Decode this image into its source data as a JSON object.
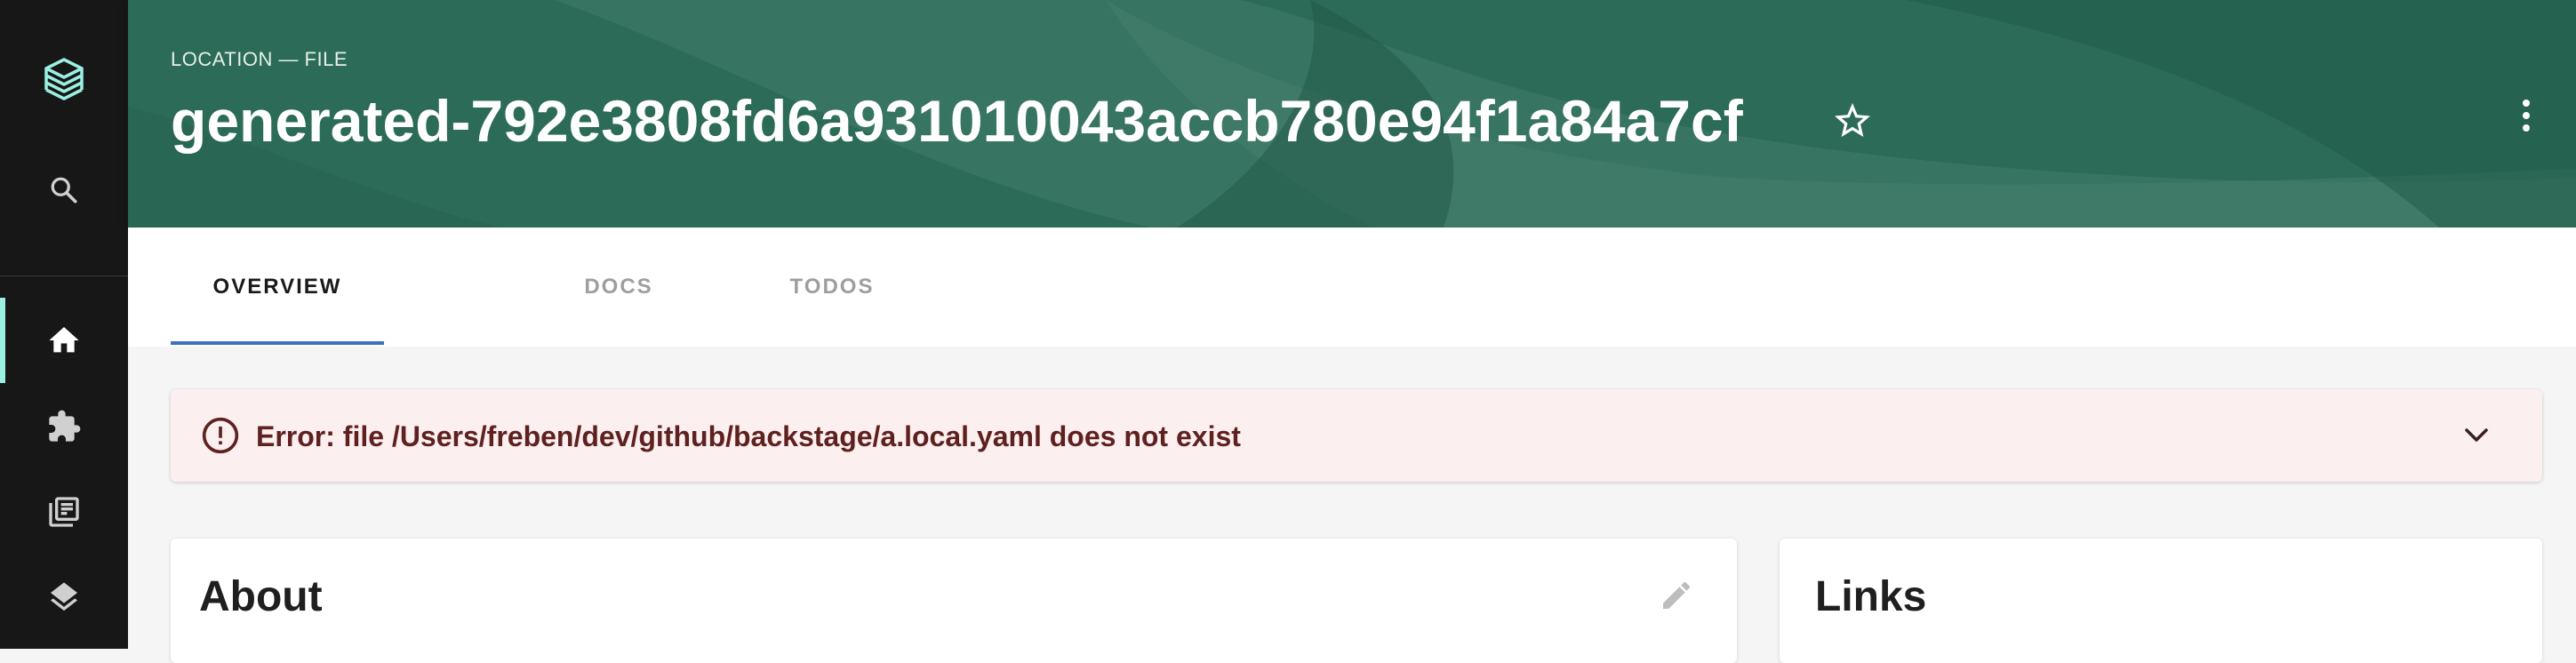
{
  "sidebar": {
    "items": [
      {
        "icon": "backstage-logo-icon"
      },
      {
        "icon": "search-icon"
      },
      {
        "icon": "home-icon",
        "active": true
      },
      {
        "icon": "puzzle-icon"
      },
      {
        "icon": "library-books-icon"
      },
      {
        "icon": "layers-icon"
      }
    ],
    "active_accent": "#9bf0e1"
  },
  "header": {
    "type_label": "LOCATION — FILE",
    "title": "generated-792e3808fd6a931010043accb780e94f1a84a7cf",
    "star_icon": "star-outline-icon",
    "menu_icon": "more-vert-icon",
    "background_color": "#2b6b57"
  },
  "tabs": [
    {
      "label": "OVERVIEW",
      "active": true
    },
    {
      "label": "DOCS",
      "active": false
    },
    {
      "label": "TODOS",
      "active": false
    }
  ],
  "alert": {
    "message": "Error: file /Users/freben/dev/github/backstage/a.local.yaml does not exist",
    "icon": "error-outline-icon",
    "toggle_icon": "chevron-down-icon",
    "color": "#5f2120",
    "background": "#fbefef"
  },
  "cards": {
    "about": {
      "title": "About",
      "edit_icon": "pencil-icon"
    },
    "links": {
      "title": "Links"
    }
  }
}
